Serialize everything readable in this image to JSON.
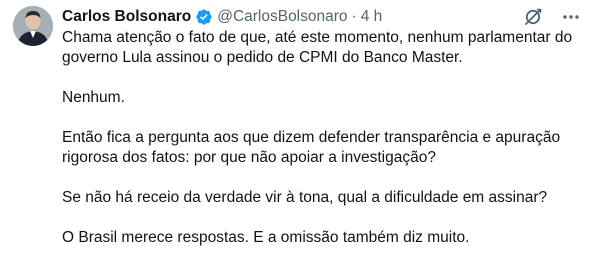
{
  "tweet": {
    "author_name": "Carlos Bolsonaro",
    "author_handle": "@CarlosBolsonaro",
    "separator": "·",
    "timestamp": "4 h",
    "verified_color": "#1d9bf0",
    "icons": {
      "verified": "verified-badge-icon",
      "grok": "grok-icon",
      "more": "more-options-icon"
    },
    "paragraphs": [
      "Chama atenção o fato de que, até este momento, nenhum parlamentar do governo Lula assinou o pedido de CPMI do Banco Master.",
      "Nenhum.",
      "Então fica a pergunta aos que dizem defender transparência e apuração rigorosa dos fatos: por que não apoiar a investigação?",
      "Se não há receio da verdade vir à tona, qual a dificuldade em assinar?",
      "O Brasil merece respostas. E a omissão também diz muito."
    ]
  }
}
